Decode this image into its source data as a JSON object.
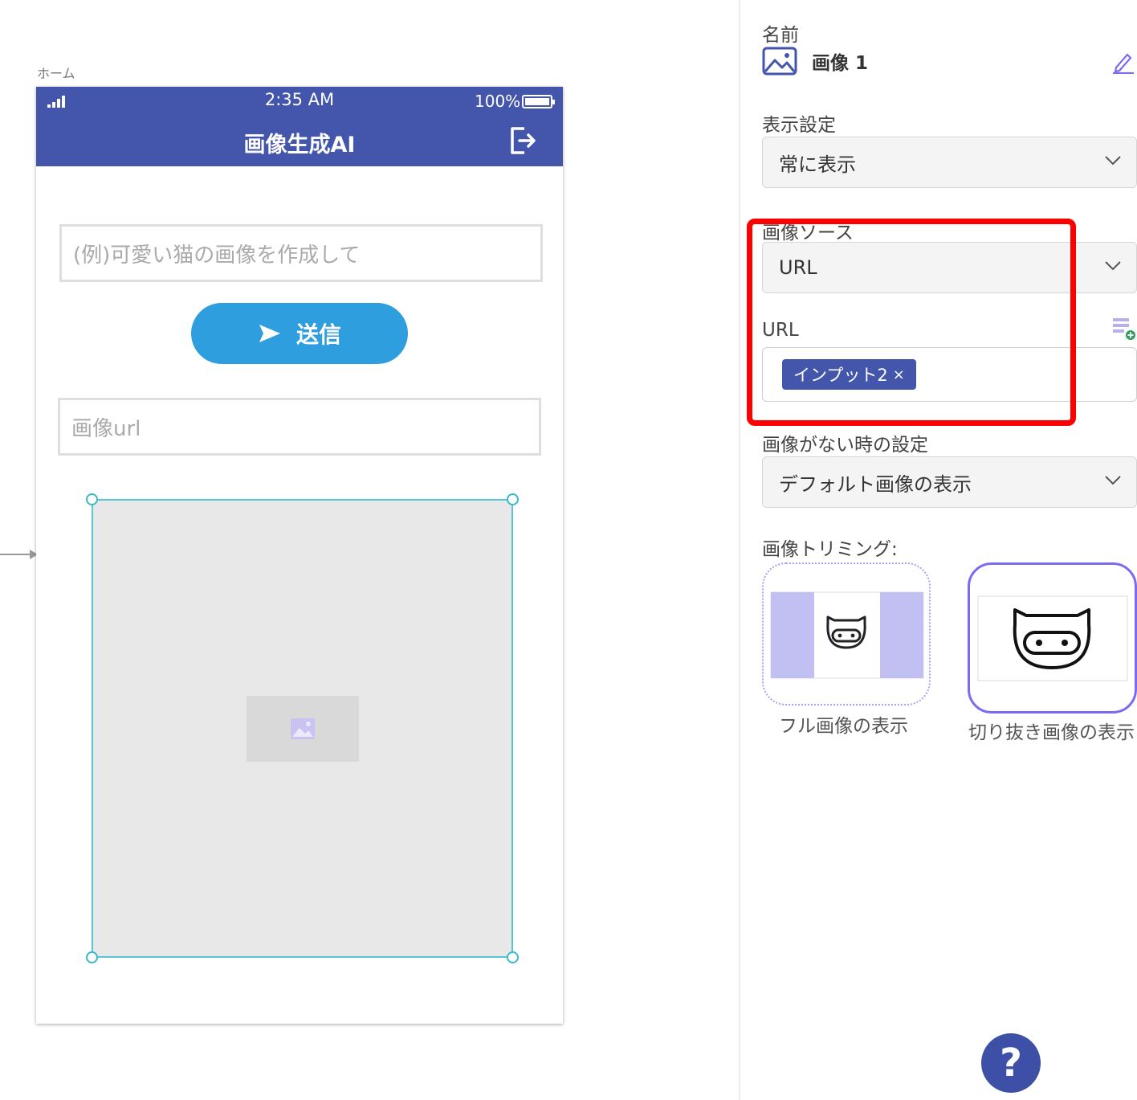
{
  "canvas": {
    "screen_label": "ホーム"
  },
  "phone": {
    "status": {
      "time": "2:35 AM",
      "battery": "100%"
    },
    "header": {
      "title": "画像生成AI",
      "logout_icon": "logout-icon"
    },
    "prompt_input": {
      "placeholder": "(例)可愛い猫の画像を作成して"
    },
    "send_button": {
      "label": "送信",
      "icon": "send-icon"
    },
    "url_input": {
      "placeholder": "画像url"
    },
    "image": {
      "icon": "image-placeholder-icon"
    }
  },
  "panel": {
    "name": {
      "label": "名前",
      "value": "画像 1",
      "icon": "image-icon",
      "edit_icon": "pencil-icon"
    },
    "visibility": {
      "label": "表示設定",
      "value": "常に表示"
    },
    "image_source": {
      "label": "画像ソース",
      "value": "URL"
    },
    "url": {
      "label": "URL",
      "token": "インプット2",
      "token_remove": "×"
    },
    "no_image": {
      "label": "画像がない時の設定",
      "value": "デフォルト画像の表示"
    },
    "trimming": {
      "label": "画像トリミング:",
      "options": [
        {
          "label": "フル画像の表示",
          "selected": false
        },
        {
          "label": "切り抜き画像の表示",
          "selected": true
        }
      ]
    },
    "help": {
      "label": "?"
    }
  },
  "colors": {
    "header_bg": "#4356ab",
    "send_button_bg": "#2f9ede",
    "selection_outline": "#58c4d4",
    "highlight": "#ff0000",
    "accent_purple": "#7b6bf2"
  }
}
